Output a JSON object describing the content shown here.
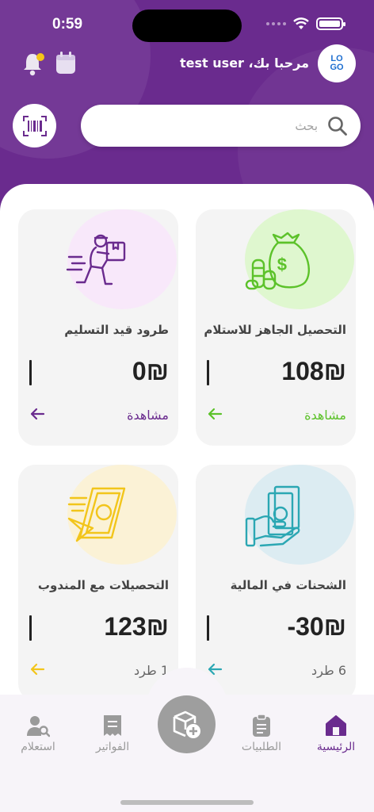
{
  "status": {
    "time": "0:59"
  },
  "header": {
    "logo_line1": "LO",
    "logo_line2": "GO",
    "greeting": "مرحبا بك، test user"
  },
  "search": {
    "placeholder": "بحث"
  },
  "cards": [
    {
      "title": "التحصيل الجاهز للاستلام",
      "value": "108₪",
      "link": "مشاهدة",
      "accent": "#5cc22a",
      "circle": "#dff7cf",
      "icon": "money-bag-icon"
    },
    {
      "title": "طرود قيد التسليم",
      "value": "0₪",
      "link": "مشاهدة",
      "accent": "#6a2b8e",
      "circle": "#f8e8fa",
      "icon": "delivery-courier-icon"
    },
    {
      "title": "الشحنات في المالية",
      "value": "-30₪",
      "link": "6 طرد",
      "accent": "#2ba7b3",
      "circle": "#dcecf2",
      "icon": "hand-cash-icon"
    },
    {
      "title": "التحصيلات مع المندوب",
      "value": "123₪",
      "link": "1 طرد",
      "accent": "#f2c51b",
      "circle": "#fbf2d6",
      "icon": "money-transfer-icon"
    }
  ],
  "nav": {
    "home": "الرئيسية",
    "orders": "الطلبيات",
    "invoices": "الفواتير",
    "inquiry": "استعلام"
  },
  "colors": {
    "primary": "#6a2b8e"
  }
}
